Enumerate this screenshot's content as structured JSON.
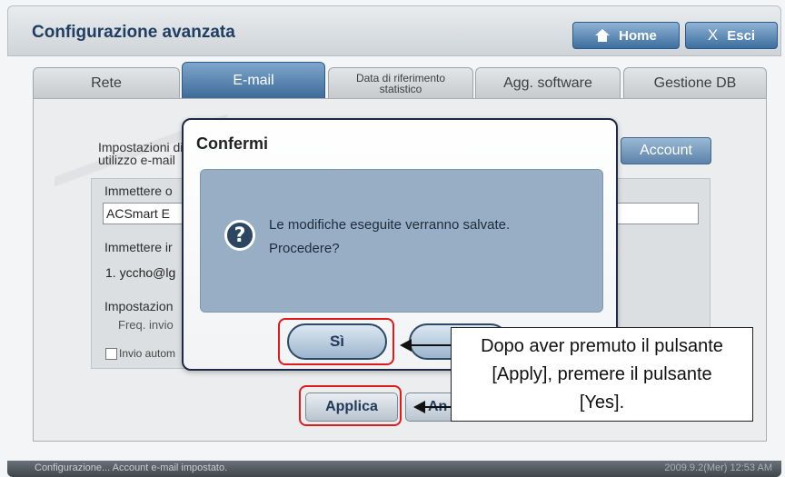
{
  "header": {
    "title": "Configurazione avanzata",
    "home_label": "Home",
    "exit_label": "Esci"
  },
  "tabs": [
    {
      "label": "Rete",
      "active": false
    },
    {
      "label": "E-mail",
      "active": true
    },
    {
      "label": "Data di riferimento statistico",
      "active": false
    },
    {
      "label": "Agg. software",
      "active": false
    },
    {
      "label": "Gestione DB",
      "active": false
    }
  ],
  "email_settings": {
    "section_label": "Impostazioni di utilizzo e-mail",
    "account_button": "Account",
    "sender_label": "Immettere o",
    "sender_value": "ACSmart E",
    "recipient_label": "Immettere ir",
    "recipient_value": "1. yccho@lg",
    "schedule_label": "Impostazion",
    "frequency_label": "Freq. invio",
    "auto_send_label": "Invio autom",
    "apply_button": "Applica",
    "cancel_button": "An"
  },
  "dialog": {
    "title": "Confermi",
    "message_line1": "Le modifiche eseguite verranno salvate.",
    "message_line2": "Procedere?",
    "yes_button": "Sì"
  },
  "callout": {
    "line1": "Dopo aver premuto il pulsante",
    "line2": "[Apply], premere il pulsante",
    "line3": "[Yes]."
  },
  "status_bar": {
    "text": "Configurazione... Account e-mail impostato.",
    "datetime": "2009.9.2(Mer)  12:53 AM"
  },
  "colors": {
    "accent": "#3d6b99",
    "title_text": "#1f3e63",
    "highlight": "#e01a1a"
  }
}
